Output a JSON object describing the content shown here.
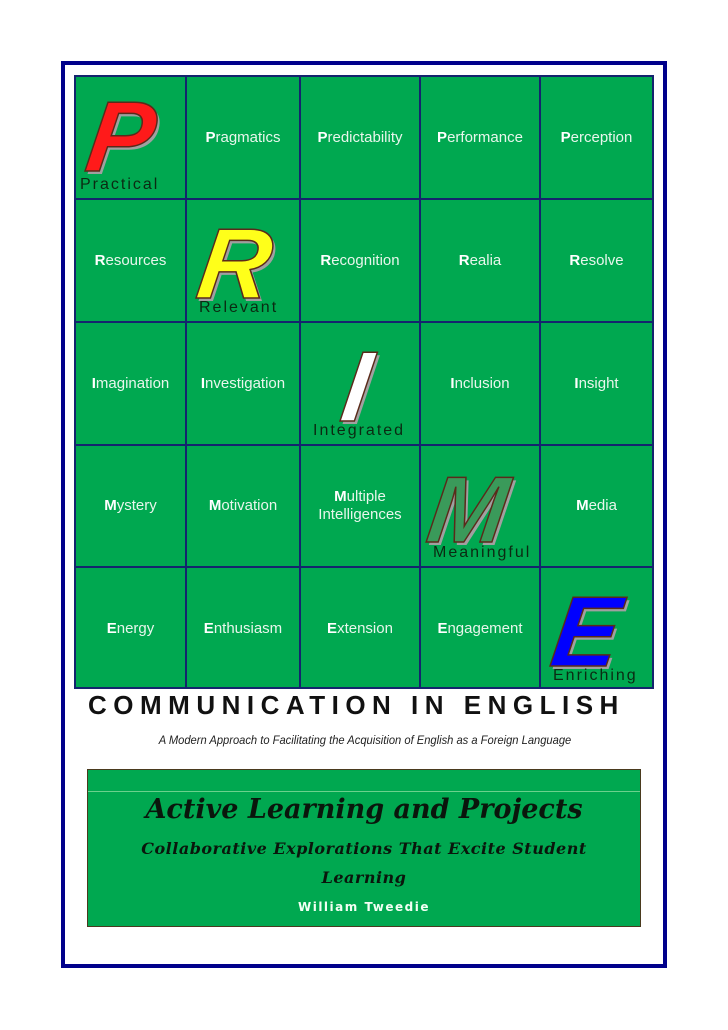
{
  "grid": {
    "rows": [
      {
        "letter": "P",
        "letter_color": "#ff1a1a",
        "caption": "Practical",
        "letter_column": 0,
        "cells": [
          {
            "first": "",
            "rest": ""
          },
          {
            "first": "P",
            "rest": "ragmatics"
          },
          {
            "first": "P",
            "rest": "redictability"
          },
          {
            "first": "P",
            "rest": "erformance"
          },
          {
            "first": "P",
            "rest": "erception"
          }
        ]
      },
      {
        "letter": "R",
        "letter_color": "#ffff1a",
        "caption": "Relevant",
        "letter_column": 1,
        "cells": [
          {
            "first": "R",
            "rest": "esources"
          },
          {
            "first": "",
            "rest": ""
          },
          {
            "first": "R",
            "rest": "ecognition"
          },
          {
            "first": "R",
            "rest": "ealia"
          },
          {
            "first": "R",
            "rest": "esolve"
          }
        ]
      },
      {
        "letter": "I",
        "letter_color": "#ffffff",
        "caption": "Integrated",
        "letter_column": 2,
        "cells": [
          {
            "first": "I",
            "rest": "magination"
          },
          {
            "first": "I",
            "rest": "nvestigation"
          },
          {
            "first": "",
            "rest": ""
          },
          {
            "first": "I",
            "rest": "nclusion"
          },
          {
            "first": "I",
            "rest": "nsight"
          }
        ]
      },
      {
        "letter": "M",
        "letter_color": "#3a9a5a",
        "caption": "Meaningful",
        "letter_column": 3,
        "cells": [
          {
            "first": "M",
            "rest": "ystery"
          },
          {
            "first": "M",
            "rest": "otivation"
          },
          {
            "first": "M",
            "rest": "ultiple",
            "line2": "Intelligences"
          },
          {
            "first": "",
            "rest": ""
          },
          {
            "first": "M",
            "rest": "edia"
          }
        ]
      },
      {
        "letter": "E",
        "letter_color": "#0000ff",
        "caption": "Enriching",
        "letter_column": 4,
        "cells": [
          {
            "first": "E",
            "rest": "nergy"
          },
          {
            "first": "E",
            "rest": "nthusiasm"
          },
          {
            "first": "E",
            "rest": "xtension"
          },
          {
            "first": "E",
            "rest": "ngagement"
          },
          {
            "first": "",
            "rest": ""
          }
        ]
      }
    ]
  },
  "title": "COMMUNICATION IN ENGLISH",
  "tagline": "A Modern Approach to Facilitating the Acquisition of English as a Foreign Language",
  "banner": {
    "title": "Active Learning and Projects",
    "subtitle": "Collaborative Explorations That Excite Student Learning",
    "author": "William Tweedie"
  }
}
